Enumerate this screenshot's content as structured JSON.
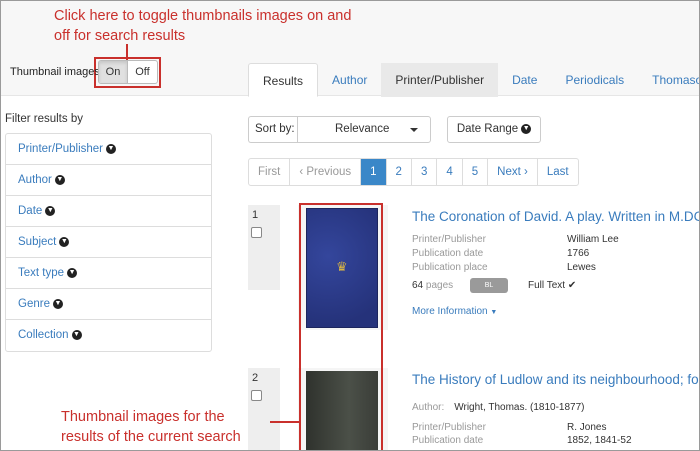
{
  "callouts": {
    "top": "Click here to toggle thumbnails images on and off for search results",
    "bottom": "Thumbnail images for the results of the current search"
  },
  "thumbnail_toggle": {
    "label": "Thumbnail images:",
    "on": "On",
    "off": "Off"
  },
  "tabs": [
    {
      "label": "Results"
    },
    {
      "label": "Author"
    },
    {
      "label": "Printer/Publisher"
    },
    {
      "label": "Date"
    },
    {
      "label": "Periodicals"
    },
    {
      "label": "Thomason Tra"
    }
  ],
  "filters": {
    "title": "Filter results by",
    "items": [
      "Printer/Publisher",
      "Author",
      "Date",
      "Subject",
      "Text type",
      "Genre",
      "Collection"
    ]
  },
  "sort": {
    "label": "Sort by:",
    "value": "Relevance",
    "date_range": "Date Range"
  },
  "pagination": {
    "first": "First",
    "previous": "‹ Previous",
    "pages": [
      "1",
      "2",
      "3",
      "4",
      "5"
    ],
    "next": "Next ›",
    "last": "Last"
  },
  "results": [
    {
      "number": "1",
      "title": "The Coronation of David. A play. Written in M.DCC",
      "fields": [
        {
          "label": "Printer/Publisher",
          "value": "William Lee"
        },
        {
          "label": "Publication date",
          "value": "1766"
        },
        {
          "label": "Publication place",
          "value": "Lewes"
        }
      ],
      "pages": "64",
      "pages_unit": "pages",
      "badge": "BL",
      "fulltext": "Full Text",
      "more": "More Information"
    },
    {
      "number": "2",
      "title": "The History of Ludlow and its neighbourhood; form",
      "author_label": "Author:",
      "author": "Wright, Thomas. (1810-1877)",
      "fields": [
        {
          "label": "Printer/Publisher",
          "value": "R. Jones"
        },
        {
          "label": "Publication date",
          "value": "1852, 1841-52"
        }
      ]
    }
  ],
  "colors": {
    "accent": "#c9302c",
    "link": "#3a7cbd",
    "active_page": "#3a87c8",
    "cover_1": "#2a3a8c"
  },
  "icons": [
    "chevron-down-circle-icon",
    "caret-down-icon",
    "checkmark-icon",
    "crown-icon"
  ]
}
